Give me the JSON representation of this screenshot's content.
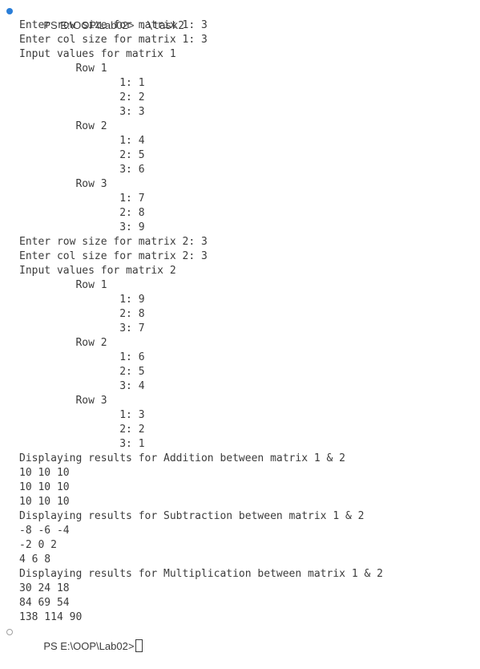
{
  "terminal": {
    "first_prompt": "PS E:\\OOP\\Lab02>",
    "first_command": " .\\task2",
    "output_lines": [
      "Enter row size for matrix 1: 3",
      "Enter col size for matrix 1: 3",
      "Input values for matrix 1",
      "         Row 1",
      "                1: 1",
      "                2: 2",
      "                3: 3",
      "         Row 2",
      "                1: 4",
      "                2: 5",
      "                3: 6",
      "         Row 3",
      "                1: 7",
      "                2: 8",
      "                3: 9",
      "Enter row size for matrix 2: 3",
      "Enter col size for matrix 2: 3",
      "Input values for matrix 2",
      "         Row 1",
      "                1: 9",
      "                2: 8",
      "                3: 7",
      "         Row 2",
      "                1: 6",
      "                2: 5",
      "                3: 4",
      "         Row 3",
      "                1: 3",
      "                2: 2",
      "                3: 1",
      "Displaying results for Addition between matrix 1 & 2",
      "10 10 10",
      "10 10 10",
      "10 10 10",
      "Displaying results for Subtraction between matrix 1 & 2",
      "-8 -6 -4",
      "-2 0 2",
      "4 6 8",
      "Displaying results for Multiplication between matrix 1 & 2",
      "30 24 18",
      "84 69 54",
      "138 114 90"
    ],
    "last_prompt": "PS E:\\OOP\\Lab02>",
    "colors": {
      "success_dot": "#2a7ed8",
      "idle_dot": "#a0a0a0",
      "text": "#3b3b3b",
      "background": "#ffffff"
    }
  }
}
